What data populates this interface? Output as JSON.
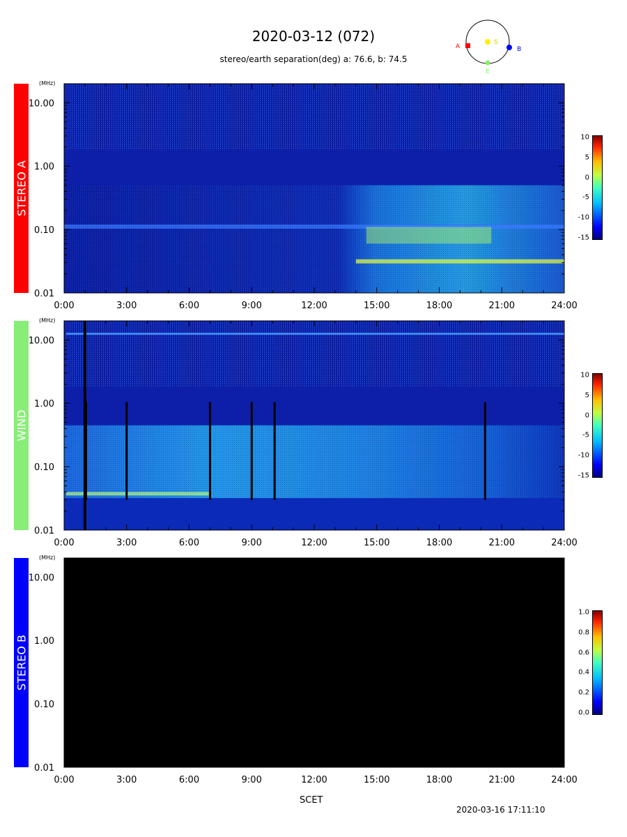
{
  "header": {
    "title": "2020-03-12 (072)",
    "subtitle": "stereo/earth separation(deg) a:  76.6, b:  74.5"
  },
  "orbit_diagram": {
    "labels": {
      "a": "A",
      "s": "S",
      "b": "B",
      "e": "E"
    },
    "colors": {
      "a": "#ff0000",
      "s": "#ffee00",
      "b": "#0000ff",
      "e": "#88ee66"
    }
  },
  "panels": [
    {
      "label": "STEREO A",
      "color": "#ff0000",
      "text_color": "#ffffff",
      "background": "spectrogram"
    },
    {
      "label": "WIND",
      "color": "#88ee77",
      "text_color": "#ffffff",
      "background": "spectrogram"
    },
    {
      "label": "STEREO B",
      "color": "#0000ff",
      "text_color": "#ffffff",
      "background": "black"
    }
  ],
  "chart_data": {
    "type": "heatmap",
    "y_unit": "(MHz)",
    "y_scale": "log",
    "ylim": [
      0.01,
      20
    ],
    "y_ticks": [
      "10.00",
      "1.00",
      "0.10",
      "0.01"
    ],
    "y_tick_values": [
      10,
      1,
      0.1,
      0.01
    ],
    "x_ticks": [
      "0:00",
      "3:00",
      "6:00",
      "9:00",
      "12:00",
      "15:00",
      "18:00",
      "21:00",
      "24:00"
    ],
    "xlim_hours": [
      0,
      24
    ],
    "xlabel": "SCET",
    "colorbars": [
      {
        "panel": "STEREO A",
        "ticks": [
          "10",
          "5",
          "0",
          "-5",
          "-10",
          "-15"
        ],
        "range": [
          -15,
          10
        ]
      },
      {
        "panel": "WIND",
        "ticks": [
          "10",
          "5",
          "0",
          "-5",
          "-10",
          "-15"
        ],
        "range": [
          -15,
          10
        ]
      },
      {
        "panel": "STEREO B",
        "ticks": [
          "1.0",
          "0.8",
          "0.6",
          "0.4",
          "0.2",
          "0.0"
        ],
        "range": [
          0,
          1
        ]
      }
    ]
  },
  "footer": {
    "xlabel": "SCET",
    "timestamp": "2020-03-16 17:11:10"
  }
}
